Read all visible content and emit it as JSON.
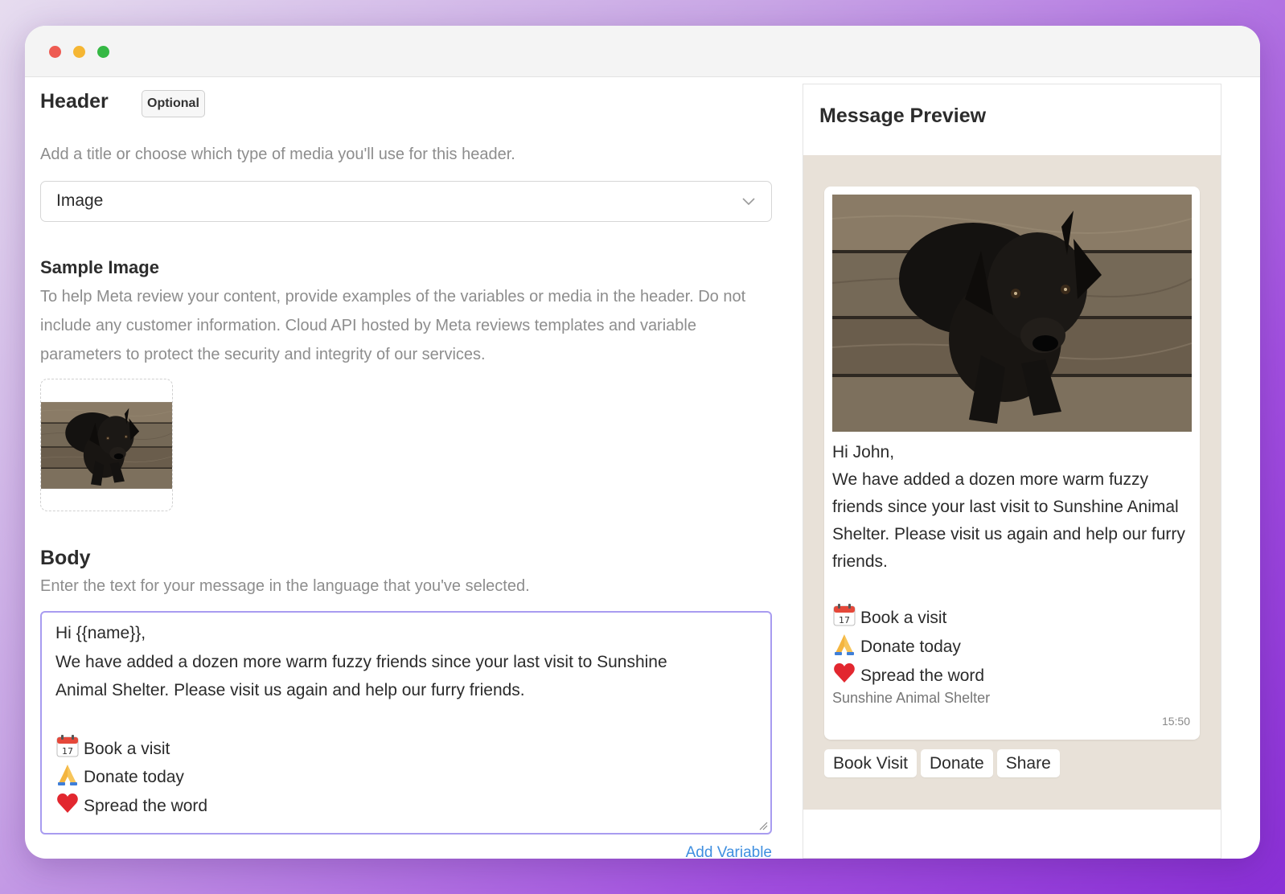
{
  "header": {
    "title": "Header",
    "optional_badge": "Optional",
    "hint": "Add a title or choose which type of media you'll use for this header.",
    "media_type": "Image"
  },
  "sample_image": {
    "title": "Sample Image",
    "hint": "To help Meta review your content, provide examples of the variables or media in the header. Do not include any customer information. Cloud API hosted by Meta reviews templates and variable parameters to protect the security and integrity of our services."
  },
  "body": {
    "title": "Body",
    "hint": "Enter the text for your message in the language that you've selected.",
    "lines": [
      "Hi {{name}},",
      "We have added a dozen more warm fuzzy friends since your last visit to Sunshine",
      "Animal Shelter. Please visit us again and help our furry friends."
    ],
    "items": [
      "Book a visit",
      "Donate today",
      "Spread the word"
    ],
    "add_variable": "Add Variable"
  },
  "preview": {
    "title": "Message Preview",
    "greeting": "Hi John,",
    "message": "We have added a dozen more warm fuzzy friends since your last visit to Sunshine Animal Shelter. Please visit us again and help our furry friends.",
    "items": [
      "Book a visit",
      "Donate today",
      "Spread the word"
    ],
    "footer": "Sunshine Animal Shelter",
    "time": "15:50",
    "buttons": [
      "Book Visit",
      "Donate",
      "Share"
    ]
  },
  "icons": [
    "calendar-icon",
    "folded-hands-icon",
    "heart-icon",
    "chevron-down-icon"
  ],
  "colors": {
    "accent_border": "#a89cf0",
    "link": "#3f8fe0",
    "chat_bg": "#e8e1d8"
  }
}
